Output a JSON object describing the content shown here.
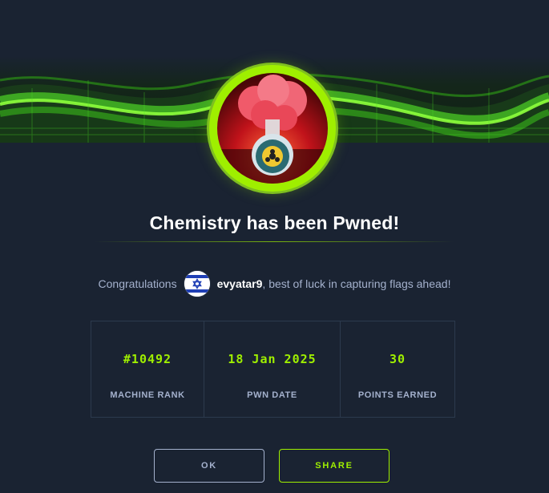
{
  "title": "Chemistry has been Pwned!",
  "congrats": {
    "prefix": "Congratulations",
    "username": "evyatar9",
    "suffix": ", best of luck in capturing flags ahead!"
  },
  "stats": [
    {
      "value": "#10492",
      "label": "MACHINE RANK"
    },
    {
      "value": "18 Jan 2025",
      "label": "PWN DATE"
    },
    {
      "value": "30",
      "label": "POINTS EARNED"
    }
  ],
  "buttons": {
    "ok": "OK",
    "share": "SHARE"
  },
  "colors": {
    "background": "#1a2332",
    "accent": "#9fef00",
    "text_muted": "#a4b1cd",
    "text_white": "#ffffff"
  },
  "icons": {
    "banner": "green-cube-wave-banner",
    "machine_avatar": "red-potion-flask-biohazard",
    "user_flag": "israel-flag"
  }
}
